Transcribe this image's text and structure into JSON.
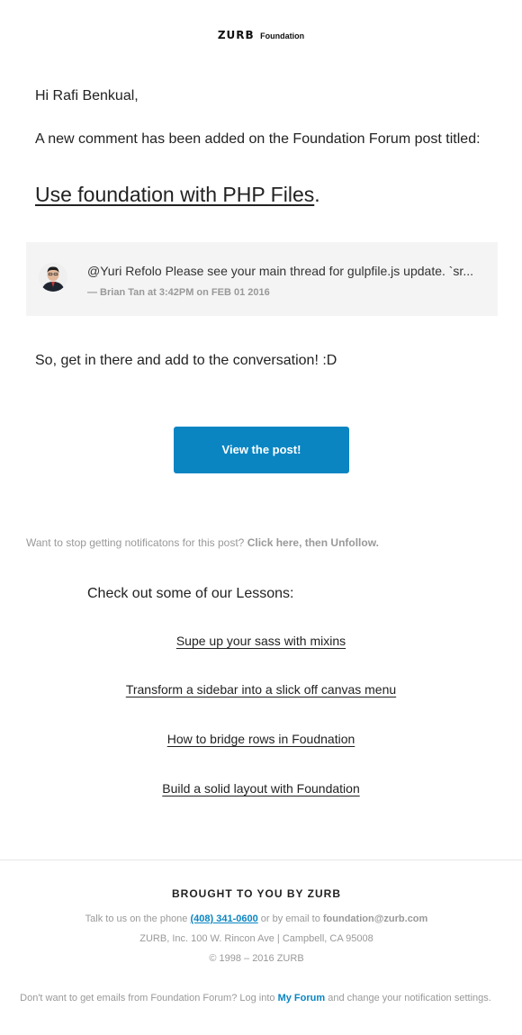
{
  "header": {
    "logo_mark": "ZURB",
    "logo_sub": "Foundation"
  },
  "email": {
    "greeting": "Hi Rafi Benkual,",
    "intro": "A new comment has been added on the Foundation Forum post titled:",
    "post_title": "Use foundation with PHP Files",
    "post_title_suffix": ".",
    "comment": {
      "text": "@Yuri Refolo Please see your main thread for gulpfile.js update. `sr...",
      "meta": "— Brian Tan at 3:42PM on FEB 01 2016"
    },
    "cta_text": "So, get in there and add to the conversation! :D",
    "button_label": "View the post!",
    "unfollow_text": "Want to stop getting notificatons for this post?",
    "unfollow_link": "Click here, then Unfollow."
  },
  "lessons": {
    "title": "Check out some of our Lessons:",
    "items": [
      "Supe up your sass with mixins",
      "Transform a sidebar into a slick off canvas menu",
      "How to bridge rows in Foudnation",
      "Build a solid layout with Foundation"
    ]
  },
  "footer": {
    "title": "BROUGHT TO YOU BY ZURB",
    "contact_prefix": "Talk to us on the phone",
    "phone": "(408) 341-0600",
    "contact_mid": "or by email to",
    "email": "foundation@zurb.com",
    "address": "ZURB, Inc. 100 W. Rincon Ave | Campbell, CA 95008",
    "copyright": "© 1998 – 2016 ZURB",
    "settings_prefix": "Don't want to get emails from Foundation Forum? Log into",
    "settings_link": "My Forum",
    "settings_suffix": "and change your notification settings."
  },
  "colors": {
    "accent": "#0a85c2",
    "muted": "#999999",
    "comment_bg": "#f4f4f4"
  }
}
